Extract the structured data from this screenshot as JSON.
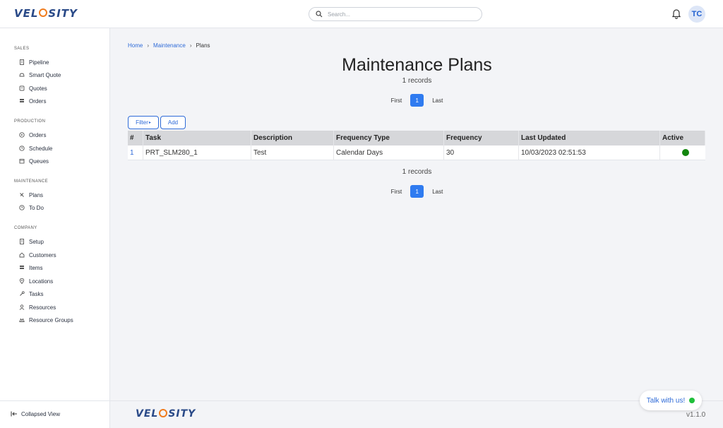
{
  "app": {
    "logo_text_left": "VEL",
    "logo_text_right": "SITY"
  },
  "header": {
    "search_placeholder": "Search...",
    "avatar_initials": "TC"
  },
  "sidebar": {
    "sections": [
      {
        "title": "SALES",
        "items": [
          {
            "label": "Pipeline",
            "icon": "building-icon"
          },
          {
            "label": "Smart Quote",
            "icon": "hat-icon"
          },
          {
            "label": "Quotes",
            "icon": "document-icon"
          },
          {
            "label": "Orders",
            "icon": "stack-icon"
          }
        ]
      },
      {
        "title": "PRODUCTION",
        "items": [
          {
            "label": "Orders",
            "icon": "play-icon"
          },
          {
            "label": "Schedule",
            "icon": "clock-icon"
          },
          {
            "label": "Queues",
            "icon": "calendar-icon"
          }
        ]
      },
      {
        "title": "MAINTENANCE",
        "items": [
          {
            "label": "Plans",
            "icon": "tools-icon"
          },
          {
            "label": "To Do",
            "icon": "clock-icon"
          }
        ]
      },
      {
        "title": "COMPANY",
        "items": [
          {
            "label": "Setup",
            "icon": "building-icon"
          },
          {
            "label": "Customers",
            "icon": "home-icon"
          },
          {
            "label": "Items",
            "icon": "stack-icon"
          },
          {
            "label": "Locations",
            "icon": "pin-icon"
          },
          {
            "label": "Tasks",
            "icon": "wrench-icon"
          },
          {
            "label": "Resources",
            "icon": "user-icon"
          },
          {
            "label": "Resource Groups",
            "icon": "group-icon"
          }
        ]
      }
    ],
    "collapse_label": "Collapsed View"
  },
  "breadcrumb": {
    "home": "Home",
    "section": "Maintenance",
    "current": "Plans"
  },
  "main": {
    "title": "Maintenance Plans",
    "records_text": "1 records",
    "pager": {
      "first": "First",
      "current": "1",
      "last": "Last"
    },
    "filter_label": "Filter",
    "add_label": "Add"
  },
  "table": {
    "columns": [
      "#",
      "Task",
      "Description",
      "Frequency Type",
      "Frequency",
      "Last Updated",
      "Active"
    ],
    "rows": [
      {
        "num": "1",
        "task": "PRT_SLM280_1",
        "description": "Test",
        "frequency_type": "Calendar Days",
        "frequency": "30",
        "last_updated": "10/03/2023 02:51:53",
        "active": true
      }
    ]
  },
  "footer": {
    "version": "v1.1.0",
    "chat_label": "Talk with us!"
  },
  "colors": {
    "accent": "#2f7bf0",
    "link": "#2f6bd8",
    "active_dot": "#13860f",
    "logo_blue": "#2a4a88",
    "logo_orange": "#f07c1e"
  }
}
